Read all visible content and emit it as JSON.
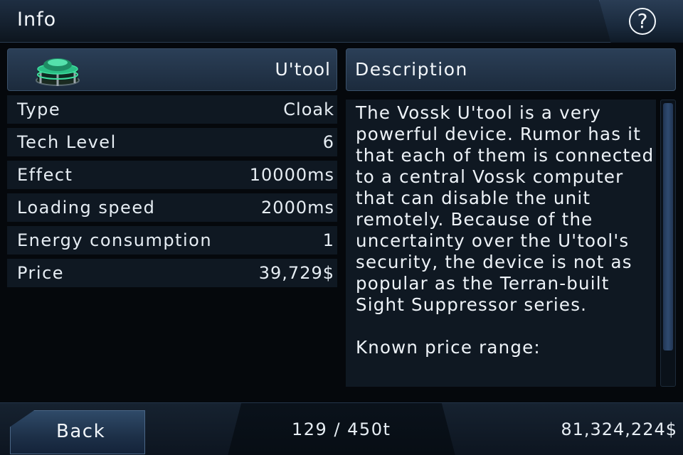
{
  "header": {
    "title": "Info",
    "help_icon": "question-mark-icon",
    "help_symbol": "?"
  },
  "item": {
    "name": "U'tool",
    "icon": "cloak-device-icon",
    "stats": [
      {
        "label": "Type",
        "value": "Cloak"
      },
      {
        "label": "Tech Level",
        "value": "6"
      },
      {
        "label": "Effect",
        "value": "10000ms"
      },
      {
        "label": "Loading speed",
        "value": "2000ms"
      },
      {
        "label": "Energy consumption",
        "value": "1"
      },
      {
        "label": "Price",
        "value": "39,729$"
      }
    ]
  },
  "description": {
    "title": "Description",
    "text": "The Vossk U'tool is a very powerful device. Rumor has it that each of them is connected to a central Vossk computer that can disable the unit remotely. Because of the uncertainty over the U'tool's security, the device is not as popular as the Terran-built Sight Suppressor series.\n\nKnown price range:"
  },
  "footer": {
    "back_label": "Back",
    "cargo": "129 / 450t",
    "credits": "81,324,224$"
  },
  "colors": {
    "accent_green": "#3fe0a0",
    "panel_blue": "#1c2b3d"
  }
}
